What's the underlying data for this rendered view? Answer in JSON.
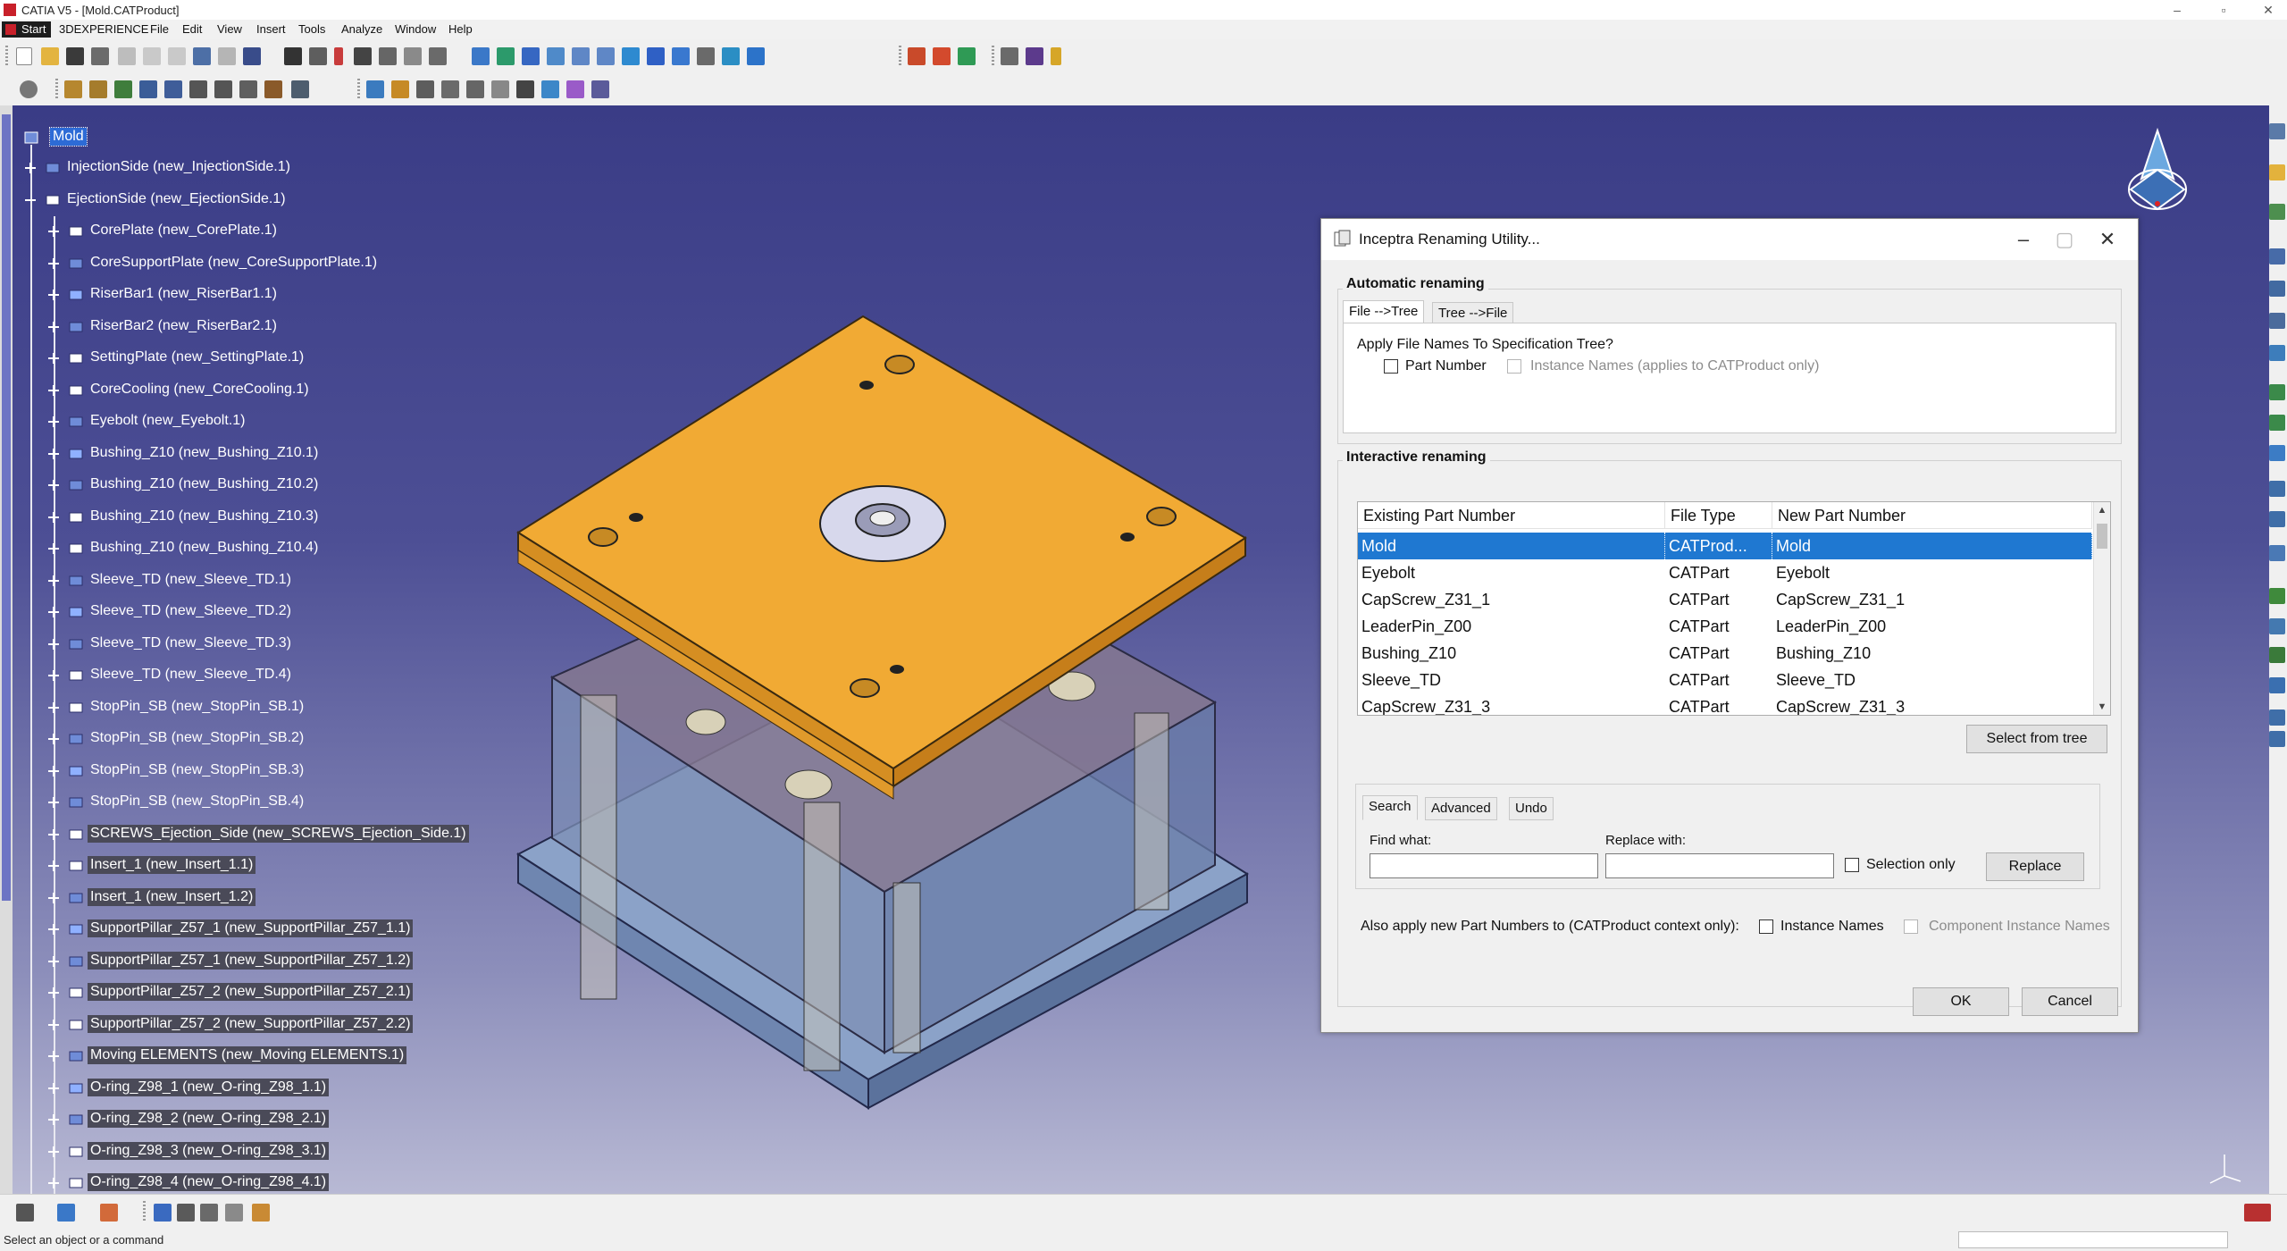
{
  "app": {
    "title": "CATIA V5 - [Mold.CATProduct]",
    "window_controls": [
      "–",
      "▫",
      "✕"
    ],
    "status_message": "Select an object or a command"
  },
  "menu": {
    "start": "Start",
    "items": [
      "3DEXPERIENCE",
      "File",
      "Edit",
      "View",
      "Insert",
      "Tools",
      "Analyze",
      "Window",
      "Help"
    ]
  },
  "tree": {
    "root": "Mold",
    "nodes": [
      {
        "label": "InjectionSide (new_InjectionSide.1)",
        "level": 1,
        "hl": false
      },
      {
        "label": "EjectionSide (new_EjectionSide.1)",
        "level": 1,
        "hl": false
      },
      {
        "label": "CorePlate (new_CorePlate.1)",
        "level": 2,
        "hl": false
      },
      {
        "label": "CoreSupportPlate (new_CoreSupportPlate.1)",
        "level": 2,
        "hl": false
      },
      {
        "label": "RiserBar1 (new_RiserBar1.1)",
        "level": 2,
        "hl": false
      },
      {
        "label": "RiserBar2 (new_RiserBar2.1)",
        "level": 2,
        "hl": false
      },
      {
        "label": "SettingPlate (new_SettingPlate.1)",
        "level": 2,
        "hl": false
      },
      {
        "label": "CoreCooling (new_CoreCooling.1)",
        "level": 2,
        "hl": false
      },
      {
        "label": "Eyebolt (new_Eyebolt.1)",
        "level": 2,
        "hl": false
      },
      {
        "label": "Bushing_Z10 (new_Bushing_Z10.1)",
        "level": 2,
        "hl": false
      },
      {
        "label": "Bushing_Z10 (new_Bushing_Z10.2)",
        "level": 2,
        "hl": false
      },
      {
        "label": "Bushing_Z10 (new_Bushing_Z10.3)",
        "level": 2,
        "hl": false
      },
      {
        "label": "Bushing_Z10 (new_Bushing_Z10.4)",
        "level": 2,
        "hl": false
      },
      {
        "label": "Sleeve_TD (new_Sleeve_TD.1)",
        "level": 2,
        "hl": false
      },
      {
        "label": "Sleeve_TD (new_Sleeve_TD.2)",
        "level": 2,
        "hl": false
      },
      {
        "label": "Sleeve_TD (new_Sleeve_TD.3)",
        "level": 2,
        "hl": false
      },
      {
        "label": "Sleeve_TD (new_Sleeve_TD.4)",
        "level": 2,
        "hl": false
      },
      {
        "label": "StopPin_SB (new_StopPin_SB.1)",
        "level": 2,
        "hl": false
      },
      {
        "label": "StopPin_SB (new_StopPin_SB.2)",
        "level": 2,
        "hl": false
      },
      {
        "label": "StopPin_SB (new_StopPin_SB.3)",
        "level": 2,
        "hl": false
      },
      {
        "label": "StopPin_SB (new_StopPin_SB.4)",
        "level": 2,
        "hl": false
      },
      {
        "label": "SCREWS_Ejection_Side (new_SCREWS_Ejection_Side.1)",
        "level": 2,
        "hl": true
      },
      {
        "label": "Insert_1 (new_Insert_1.1)",
        "level": 2,
        "hl": true
      },
      {
        "label": "Insert_1 (new_Insert_1.2)",
        "level": 2,
        "hl": true
      },
      {
        "label": "SupportPillar_Z57_1 (new_SupportPillar_Z57_1.1)",
        "level": 2,
        "hl": true
      },
      {
        "label": "SupportPillar_Z57_1 (new_SupportPillar_Z57_1.2)",
        "level": 2,
        "hl": true
      },
      {
        "label": "SupportPillar_Z57_2 (new_SupportPillar_Z57_2.1)",
        "level": 2,
        "hl": true
      },
      {
        "label": "SupportPillar_Z57_2 (new_SupportPillar_Z57_2.2)",
        "level": 2,
        "hl": true
      },
      {
        "label": "Moving ELEMENTS (new_Moving ELEMENTS.1)",
        "level": 2,
        "hl": true
      },
      {
        "label": "O-ring_Z98_1 (new_O-ring_Z98_1.1)",
        "level": 2,
        "hl": true
      },
      {
        "label": "O-ring_Z98_2 (new_O-ring_Z98_2.1)",
        "level": 2,
        "hl": true
      },
      {
        "label": "O-ring_Z98_3 (new_O-ring_Z98_3.1)",
        "level": 2,
        "hl": true
      },
      {
        "label": "O-ring_Z98_4 (new_O-ring_Z98_4.1)",
        "level": 2,
        "hl": true
      }
    ]
  },
  "dialog": {
    "title": "Inceptra Renaming Utility...",
    "auto_group": "Automatic renaming",
    "tabs": [
      "File -->Tree",
      "Tree -->File"
    ],
    "apply_question": "Apply File Names To Specification Tree?",
    "part_number": "Part Number",
    "instance_names_cat": "Instance Names (applies to CATProduct only)",
    "interactive_group": "Interactive renaming",
    "columns": [
      "Existing Part Number",
      "File Type",
      "New Part Number"
    ],
    "rows": [
      [
        "Mold",
        "CATProd...",
        "Mold"
      ],
      [
        "Eyebolt",
        "CATPart",
        "Eyebolt"
      ],
      [
        "CapScrew_Z31_1",
        "CATPart",
        "CapScrew_Z31_1"
      ],
      [
        "LeaderPin_Z00",
        "CATPart",
        "LeaderPin_Z00"
      ],
      [
        "Bushing_Z10",
        "CATPart",
        "Bushing_Z10"
      ],
      [
        "Sleeve_TD",
        "CATPart",
        "Sleeve_TD"
      ],
      [
        "CapScrew_Z31_3",
        "CATPart",
        "CapScrew_Z31_3"
      ]
    ],
    "select_from_tree": "Select from tree",
    "search_tabs": [
      "Search",
      "Advanced",
      "Undo"
    ],
    "find_what": "Find what:",
    "replace_with": "Replace with:",
    "find_value": "",
    "replace_value": "",
    "selection_only": "Selection only",
    "replace_btn": "Replace",
    "also_apply": "Also apply new Part Numbers to (CATProduct context only):",
    "instance_names": "Instance Names",
    "component_instance_names": "Component Instance Names",
    "ok": "OK",
    "cancel": "Cancel"
  },
  "colors": {
    "selection": "#1f78d1",
    "plate": "#f0a834",
    "viewport_top": "#3a3c86"
  }
}
